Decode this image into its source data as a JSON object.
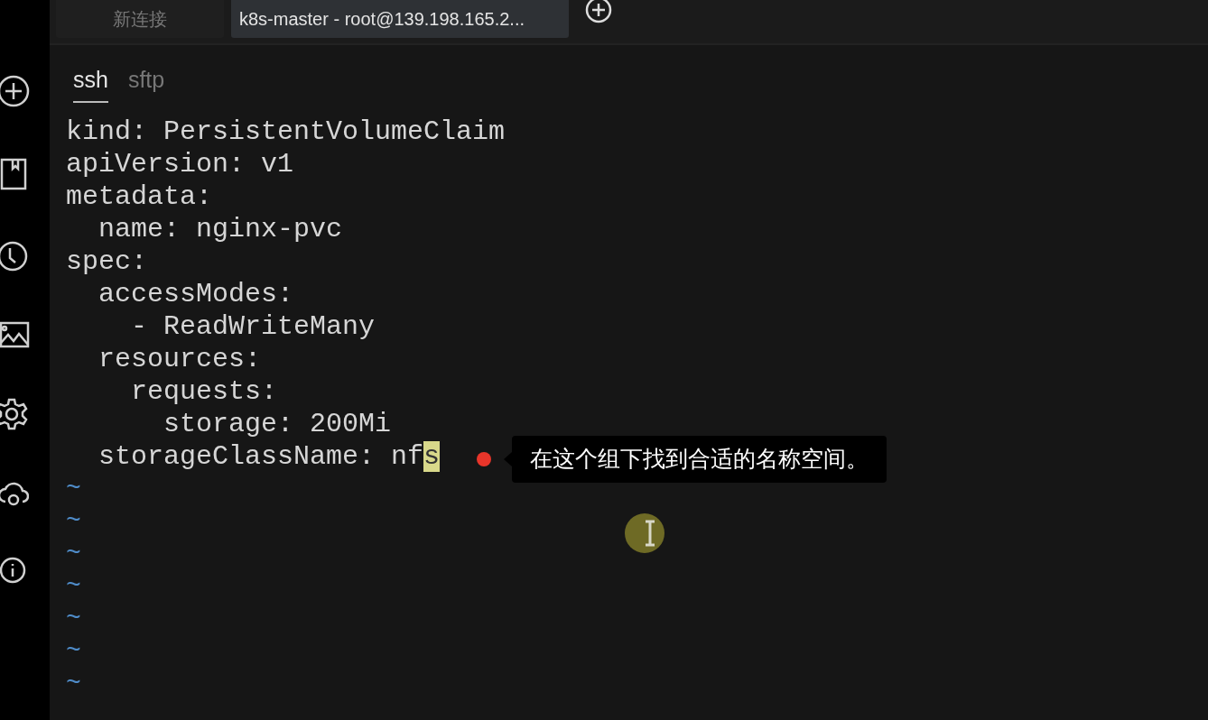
{
  "tabs": [
    {
      "label": "新连接",
      "selected": false
    },
    {
      "label": "k8s-master - root@139.198.165.2...",
      "selected": true
    }
  ],
  "sub_tabs": [
    {
      "label": "ssh",
      "selected": true
    },
    {
      "label": "sftp",
      "selected": false
    }
  ],
  "terminal": {
    "lines": [
      {
        "text": "kind: PersistentVolumeClaim"
      },
      {
        "text": "apiVersion: v1"
      },
      {
        "text": "metadata:"
      },
      {
        "text": "  name: nginx-pvc"
      },
      {
        "text": "spec:"
      },
      {
        "text": "  accessModes:"
      },
      {
        "text": "    - ReadWriteMany"
      },
      {
        "text": "  resources:"
      },
      {
        "text": "    requests:"
      },
      {
        "text": "      storage: 200Mi"
      },
      {
        "text": "  storageClassName: nf",
        "cursor_char": "s"
      },
      {
        "text": "~",
        "kind": "empty"
      },
      {
        "text": "~",
        "kind": "empty"
      },
      {
        "text": "~",
        "kind": "empty"
      },
      {
        "text": "~",
        "kind": "empty"
      },
      {
        "text": "~",
        "kind": "empty"
      },
      {
        "text": "~",
        "kind": "empty"
      },
      {
        "text": "~",
        "kind": "empty"
      }
    ]
  },
  "callout": {
    "text": "在这个组下找到合适的名称空间。"
  }
}
